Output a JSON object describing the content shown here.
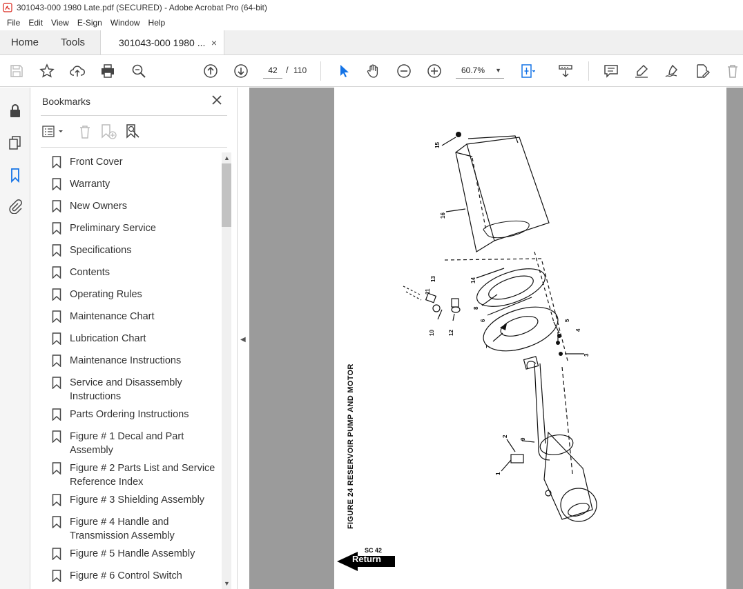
{
  "window": {
    "title": "301043-000 1980 Late.pdf (SECURED) - Adobe Acrobat Pro (64-bit)"
  },
  "menu": [
    "File",
    "Edit",
    "View",
    "E-Sign",
    "Window",
    "Help"
  ],
  "tabs": {
    "home": "Home",
    "tools": "Tools",
    "document": "301043-000 1980 ...",
    "close": "×"
  },
  "toolbar": {
    "page_current": "42",
    "page_sep": "/",
    "page_total": "110",
    "zoom": "60.7%"
  },
  "bookmarks": {
    "header": "Bookmarks",
    "items": [
      "Front Cover",
      "Warranty",
      "New Owners",
      "Preliminary Service",
      "Specifications",
      "Contents",
      "Operating Rules",
      "Maintenance Chart",
      "Lubrication Chart",
      "Maintenance Instructions",
      "Service and Disassembly Instructions",
      "Parts Ordering Instructions",
      "Figure # 1 Decal and Part Assembly",
      "Figure # 2 Parts List and Service Reference Index",
      "Figure # 3 Shielding Assembly",
      "Figure # 4 Handle and Transmission Assembly",
      "Figure # 5 Handle Assembly",
      "Figure # 6 Control Switch"
    ]
  },
  "page": {
    "caption": "FIGURE 24   RESERVOIR PUMP AND MOTOR",
    "sc_label": "SC 42",
    "return_label": "Return",
    "callouts": [
      "15",
      "16",
      "14",
      "13",
      "11",
      "8",
      "6",
      "10",
      "12",
      "5",
      "4",
      "3",
      "7",
      "2",
      "9",
      "1"
    ]
  }
}
